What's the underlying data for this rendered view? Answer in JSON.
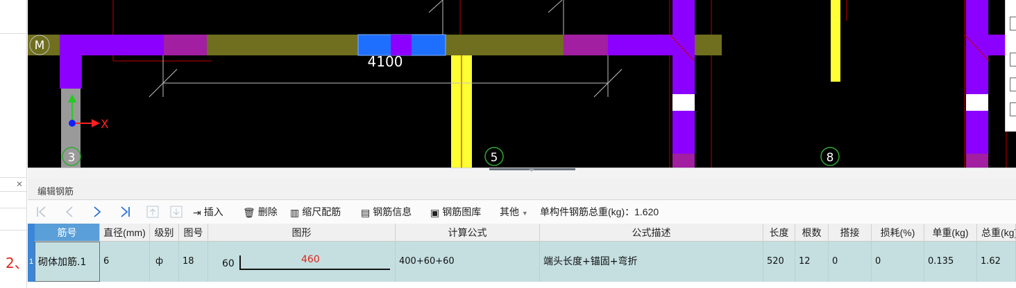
{
  "canvas": {
    "axis_labels": {
      "M": "M",
      "axis3": "3",
      "axis5": "5",
      "axis8": "8"
    },
    "dimension_value": "4100",
    "ucs_x_label": "X",
    "colors": {
      "beam_olive": "#6f6f1f",
      "wall_purple": "#8c00ff",
      "magenta": "#a11fa0",
      "yellow": "#ffff33",
      "selected_blue": "#1f6fff",
      "redline": "#c00000"
    }
  },
  "left_panel": {
    "close_icon": "close-icon",
    "annotation": "2、"
  },
  "panel": {
    "title": "编辑钢筋",
    "toolbar": {
      "first_icon": "first-record-icon",
      "prev_icon": "prev-record-icon",
      "next_icon": "next-record-icon",
      "last_icon": "last-record-icon",
      "move_up_icon": "move-up-icon",
      "move_down_icon": "move-down-icon",
      "insert_label": "插入",
      "delete_label": "删除",
      "scale_label": "缩尺配筋",
      "info_label": "钢筋信息",
      "library_label": "钢筋图库",
      "other_label": "其他",
      "total_weight_label": "单构件钢筋总重(kg)：1.620"
    },
    "table": {
      "headers": [
        "筋号",
        "直径(mm)",
        "级别",
        "图号",
        "图形",
        "计算公式",
        "公式描述",
        "长度",
        "根数",
        "搭接",
        "损耗(%)",
        "单重(kg)",
        "总重(kg)"
      ],
      "row": {
        "index": "1",
        "name": "砌体加筋.1",
        "diameter": "6",
        "grade": "ф",
        "shape_no": "18",
        "shape_left": "60",
        "shape_len": "460",
        "formula": "400+60+60",
        "description": "端头长度+锚固+弯折",
        "length": "520",
        "count": "12",
        "lap": "0",
        "loss": "0",
        "unit_weight": "0.135",
        "total_weight": "1.62"
      }
    }
  }
}
